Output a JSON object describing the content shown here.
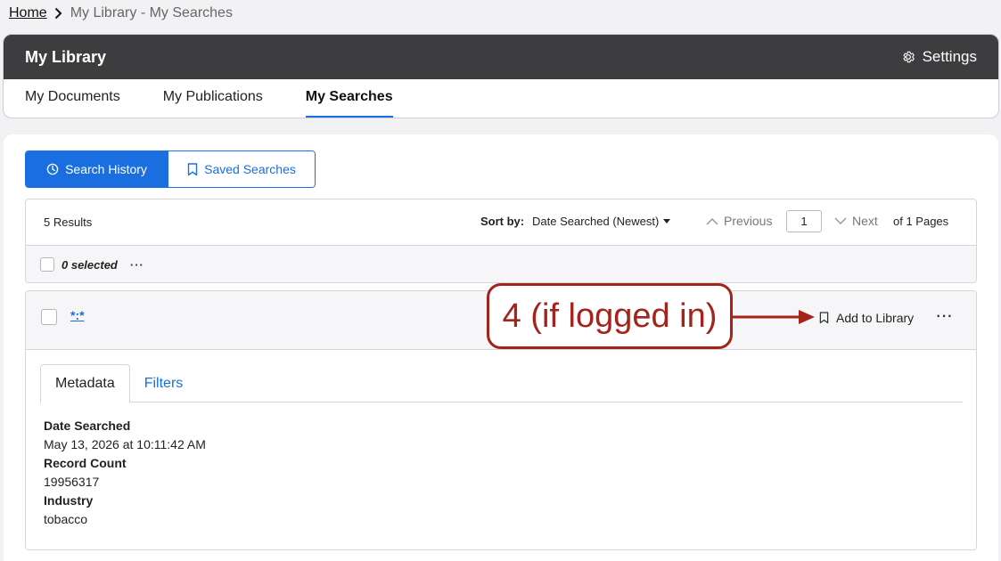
{
  "breadcrumb": {
    "home": "Home",
    "current": "My Library - My Searches"
  },
  "header": {
    "title": "My Library",
    "settings_label": "Settings"
  },
  "tabs": [
    {
      "label": "My Documents",
      "active": false
    },
    {
      "label": "My Publications",
      "active": false
    },
    {
      "label": "My Searches",
      "active": true
    }
  ],
  "segment": {
    "history_label": "Search History",
    "saved_label": "Saved Searches"
  },
  "results": {
    "count_label": "5 Results",
    "sort_label": "Sort by:",
    "sort_value": "Date Searched (Newest)",
    "previous_label": "Previous",
    "page_value": "1",
    "next_label": "Next",
    "of_pages": "of 1 Pages",
    "selected_label": "0 selected",
    "more_label": "···"
  },
  "item": {
    "query": "*:*",
    "add_to_library_label": "Add to Library",
    "more_label": "···",
    "tabs": [
      {
        "label": "Metadata",
        "active": true
      },
      {
        "label": "Filters",
        "active": false
      }
    ],
    "metadata": [
      {
        "label": "Date Searched",
        "value": "May 13, 2026 at 10:11:42 AM"
      },
      {
        "label": "Record Count",
        "value": "19956317"
      },
      {
        "label": "Industry",
        "value": "tobacco"
      }
    ]
  },
  "annotation": {
    "text": "4 (if logged in)"
  },
  "colors": {
    "accent": "#1a6ee0",
    "header_bg": "#3d3d3f",
    "annotation": "#a4231a"
  }
}
